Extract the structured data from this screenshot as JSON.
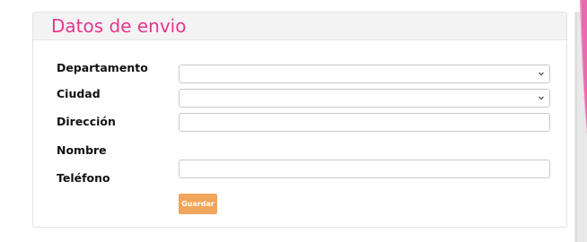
{
  "panel": {
    "title": "Datos de envio"
  },
  "form": {
    "departamento": {
      "label": "Departamento",
      "value": ""
    },
    "ciudad": {
      "label": "Ciudad",
      "value": ""
    },
    "direccion": {
      "label": "Dirección",
      "value": ""
    },
    "nombre": {
      "label": "Nombre"
    },
    "telefono": {
      "label": "Teléfono",
      "value": ""
    },
    "save_label": "Guardar"
  },
  "colors": {
    "title": "#e5388f",
    "button": "#f0a55c",
    "side_accent": "#e86bb0"
  }
}
